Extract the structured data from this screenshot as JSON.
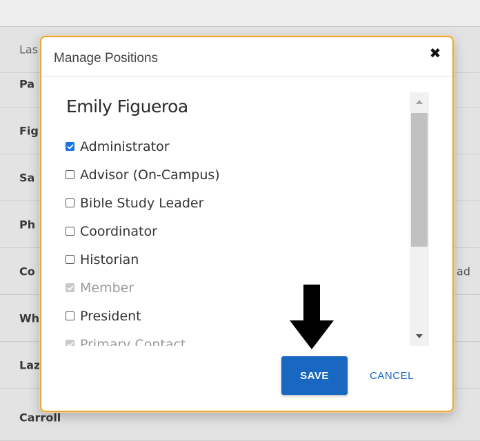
{
  "background": {
    "header_label": "Las",
    "rows": [
      {
        "name": "Pa"
      },
      {
        "name": "Fig"
      },
      {
        "name": "Sa"
      },
      {
        "name": "Ph"
      },
      {
        "name": "Co",
        "right": "ad"
      },
      {
        "name": "Wh"
      },
      {
        "name": "Laz"
      },
      {
        "name": "Carroll"
      }
    ]
  },
  "modal": {
    "title": "Manage Positions",
    "close_icon": "close-icon",
    "person_name": "Emily Figueroa",
    "positions": [
      {
        "label": "Administrator",
        "state": "checked"
      },
      {
        "label": "Advisor (On-Campus)",
        "state": "unchecked"
      },
      {
        "label": "Bible Study Leader",
        "state": "unchecked"
      },
      {
        "label": "Coordinator",
        "state": "unchecked"
      },
      {
        "label": "Historian",
        "state": "unchecked"
      },
      {
        "label": "Member",
        "state": "checked-disabled"
      },
      {
        "label": "President",
        "state": "unchecked"
      },
      {
        "label": "Primary Contact",
        "state": "checked-disabled"
      }
    ],
    "save_label": "SAVE",
    "cancel_label": "CANCEL"
  },
  "colors": {
    "primary": "#1867c0",
    "modal_border": "#e6a83a",
    "checkbox_checked": "#1a73e8",
    "checkbox_disabled": "#c9c9c9"
  }
}
